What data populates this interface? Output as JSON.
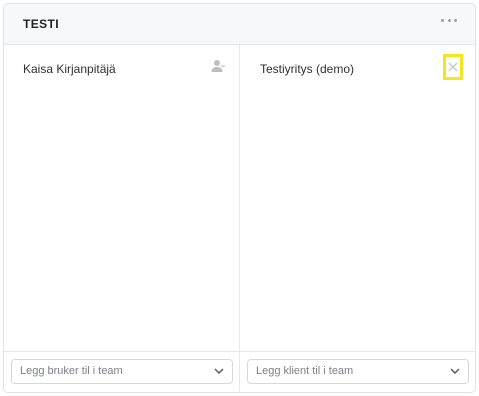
{
  "panel": {
    "title": "TESTI",
    "more_icon": "more-horizontal-icon"
  },
  "users_column": {
    "items": [
      {
        "name": "Kaisa Kirjanpitäjä",
        "icon": "user-icon"
      }
    ],
    "select": {
      "placeholder": "Legg bruker til i team",
      "icon": "chevron-down-icon"
    }
  },
  "clients_column": {
    "items": [
      {
        "name": "Testiyritys (demo)",
        "icon": "close-icon"
      }
    ],
    "select": {
      "placeholder": "Legg klient til i team",
      "icon": "chevron-down-icon"
    }
  },
  "colors": {
    "highlight": "#f5e51d",
    "border": "#dfe3e8",
    "header_bg": "#f7f8fa"
  }
}
